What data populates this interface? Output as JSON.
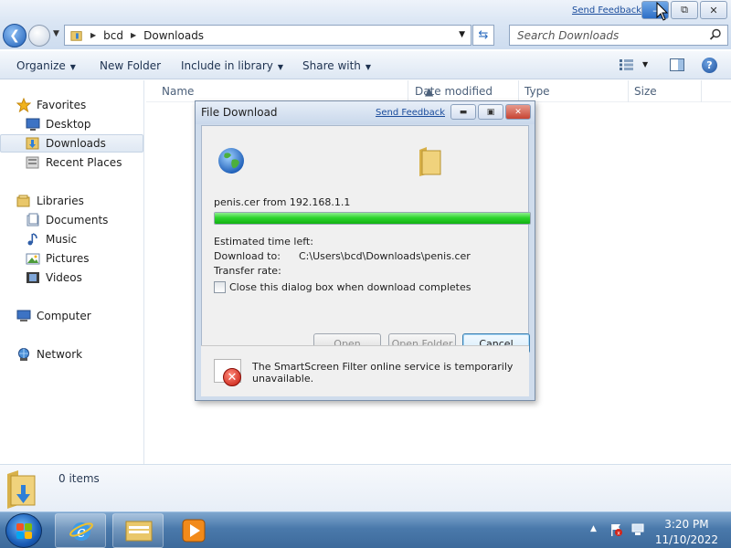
{
  "window": {
    "send_feedback": "Send Feedback",
    "minimize": "–",
    "restore": "⧉",
    "close": "✕"
  },
  "address": {
    "crumbs": [
      "bcd",
      "Downloads"
    ],
    "search_placeholder": "Search Downloads"
  },
  "toolbar": {
    "organize": "Organize",
    "new_folder": "New Folder",
    "include_in_library": "Include in library",
    "share_with": "Share with"
  },
  "sidebar": {
    "favorites": {
      "label": "Favorites",
      "items": [
        "Desktop",
        "Downloads",
        "Recent Places"
      ],
      "selected": "Downloads"
    },
    "libraries": {
      "label": "Libraries",
      "items": [
        "Documents",
        "Music",
        "Pictures",
        "Videos"
      ]
    },
    "computer": "Computer",
    "network": "Network"
  },
  "columns": [
    "Name",
    "Date modified",
    "Type",
    "Size"
  ],
  "details": {
    "count": "0 items"
  },
  "dialog": {
    "title": "File Download",
    "send_feedback": "Send Feedback",
    "file_line": "penis.cer from 192.168.1.1",
    "progress": 1.0,
    "estimated_label": "Estimated time left:",
    "download_to_label": "Download to:",
    "download_to_value": "C:\\Users\\bcd\\Downloads\\penis.cer",
    "transfer_rate_label": "Transfer rate:",
    "close_when_done": "Close this dialog box when download completes",
    "close_when_done_checked": false,
    "open_button": "Open",
    "open_folder_button": "Open Folder",
    "cancel_button": "Cancel",
    "smartscreen_msg_line1": "The SmartScreen Filter online service is temporarily",
    "smartscreen_msg_line2": "unavailable."
  },
  "taskbar": {
    "time": "3:20 PM",
    "date": "11/10/2022"
  },
  "colors": {
    "accent": "#2c6ec7",
    "progress_green": "#2ed52e",
    "error_red": "#c4170c"
  }
}
